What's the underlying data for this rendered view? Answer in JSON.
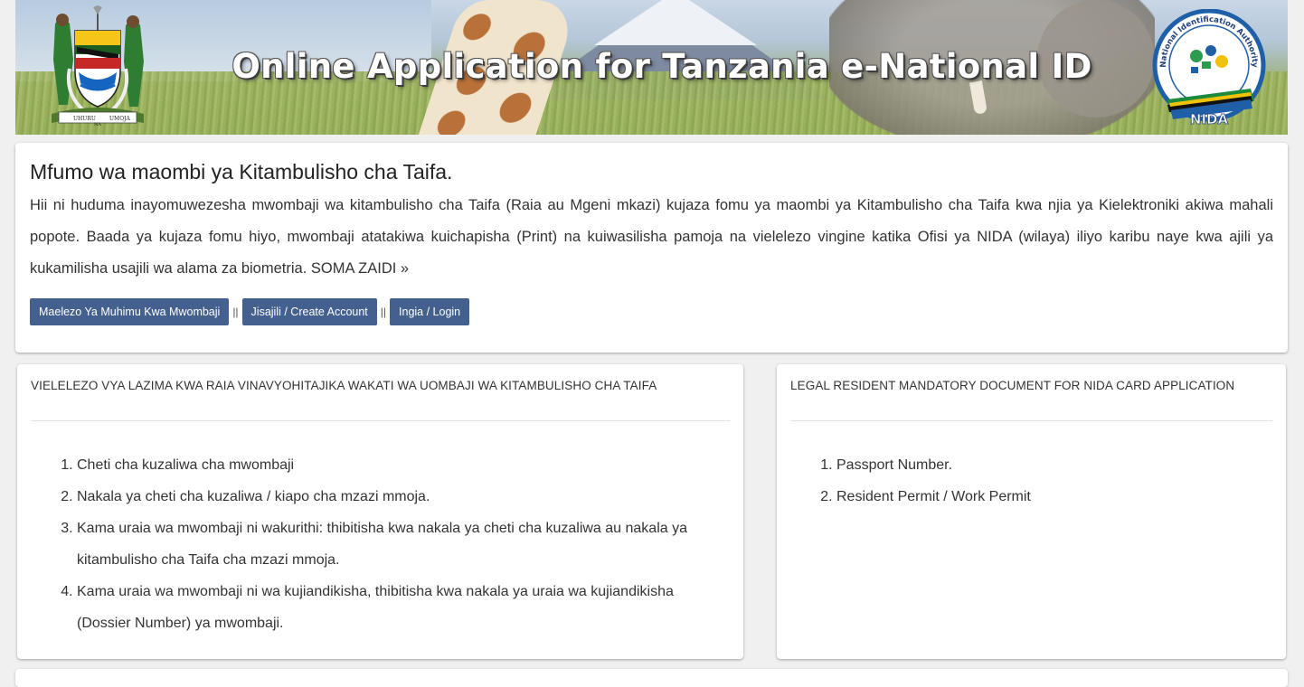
{
  "banner": {
    "title": "Online Application for Tanzania e-National ID",
    "coat_of_arms": {
      "motto_left": "UHURU",
      "motto_center": "NA",
      "motto_right": "UMOJA"
    },
    "nida_logo": {
      "ring_text": "National Identification Authority",
      "acronym": "NIDA"
    }
  },
  "intro": {
    "heading": "Mfumo wa maombi ya Kitambulisho cha Taifa.",
    "body": "Hii ni huduma inayomuwezesha mwombaji wa kitambulisho cha Taifa (Raia au Mgeni mkazi) kujaza fomu ya maombi ya Kitambulisho cha Taifa kwa njia ya Kielektroniki akiwa mahali popote. Baada ya kujaza fomu hiyo, mwombaji atatakiwa kuichapisha (Print) na kuiwasilisha pamoja na vielelezo vingine katika Ofisi ya NIDA (wilaya) iliyo karibu naye kwa ajili ya kukamilisha usajili wa alama za biometria.",
    "read_more": "SOMA ZAIDI »",
    "buttons": {
      "info": "Maelezo Ya Muhimu Kwa Mwombaji",
      "register": "Jisajili / Create Account",
      "login": "Ingia / Login"
    },
    "separator": "||"
  },
  "citizens_card": {
    "title": "VIELELEZO VYA LAZIMA KWA RAIA VINAVYOHITAJIKA WAKATI WA UOMBAJI WA KITAMBULISHO CHA TAIFA",
    "items": [
      "Cheti cha kuzaliwa cha mwombaji",
      "Nakala ya cheti cha kuzaliwa / kiapo cha mzazi mmoja.",
      "Kama uraia wa mwombaji ni wakurithi: thibitisha kwa nakala ya cheti cha kuzaliwa au nakala ya kitambulisho cha Taifa cha mzazi mmoja.",
      "Kama uraia wa mwombaji ni wa kujiandikisha, thibitisha kwa nakala ya uraia wa kujiandikisha (Dossier Number) ya mwombaji."
    ]
  },
  "residents_card": {
    "title": "LEGAL RESIDENT MANDATORY DOCUMENT FOR NIDA CARD APPLICATION",
    "items": [
      "Passport Number.",
      "Resident Permit / Work Permit"
    ]
  },
  "colors": {
    "button": "#44608f",
    "page_bg": "#f0f0f0",
    "panel_bg": "#ffffff"
  }
}
